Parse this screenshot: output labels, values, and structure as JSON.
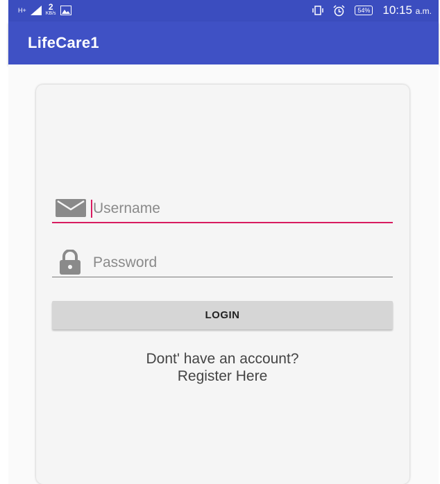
{
  "status_bar": {
    "network_label": "H+",
    "data_rate_value": "2",
    "data_rate_unit": "KB/s",
    "battery": "54%",
    "time": "10:15",
    "ampm": "a.m.",
    "icons": [
      "signal-icon",
      "image-icon",
      "vibrate-icon",
      "alarm-icon",
      "battery-icon"
    ]
  },
  "app_bar": {
    "title": "LifeCare1"
  },
  "login": {
    "username_placeholder": "Username",
    "username_value": "",
    "password_placeholder": "Password",
    "password_value": "",
    "login_label": "LOGIN",
    "register_line1": "Dont' have an account?",
    "register_line2": "Register Here"
  },
  "colors": {
    "status_bar": "#3b4dbf",
    "app_bar": "#3f51c5",
    "accent": "#d81b60",
    "button": "#d6d6d6"
  }
}
